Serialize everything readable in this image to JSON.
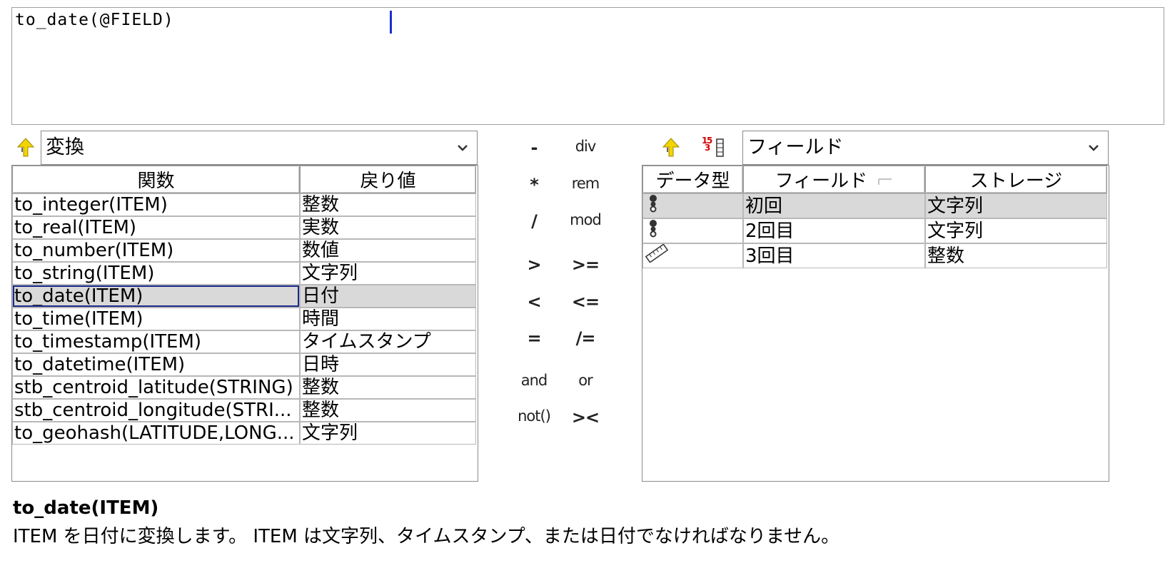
{
  "expression": {
    "text": "to_date(@FIELD)"
  },
  "functions": {
    "category": "変換",
    "columns": [
      "関数",
      "戻り値"
    ],
    "rows": [
      {
        "name": "to_integer(ITEM)",
        "ret": "整数"
      },
      {
        "name": "to_real(ITEM)",
        "ret": "実数"
      },
      {
        "name": "to_number(ITEM)",
        "ret": "数値"
      },
      {
        "name": "to_string(ITEM)",
        "ret": "文字列"
      },
      {
        "name": "to_date(ITEM)",
        "ret": "日付"
      },
      {
        "name": "to_time(ITEM)",
        "ret": "時間"
      },
      {
        "name": "to_timestamp(ITEM)",
        "ret": "タイムスタンプ"
      },
      {
        "name": "to_datetime(ITEM)",
        "ret": "日時"
      },
      {
        "name": "stb_centroid_latitude(STRING)",
        "ret": "整数"
      },
      {
        "name": "stb_centroid_longitude(STRI...",
        "ret": "整数"
      },
      {
        "name": "to_geohash(LATITUDE,LONG...",
        "ret": "文字列"
      }
    ],
    "selected_index": 4
  },
  "operators": [
    [
      "-",
      "div"
    ],
    [
      "*",
      "rem"
    ],
    [
      "/",
      "mod"
    ],
    [
      ">",
      ">="
    ],
    [
      "<",
      "<="
    ],
    [
      "=",
      "/="
    ],
    [
      "and",
      "or"
    ],
    [
      "not()",
      "><"
    ]
  ],
  "fields": {
    "category": "フィールド",
    "columns": [
      "データ型",
      "フィールド",
      "ストレージ"
    ],
    "rows": [
      {
        "type_icon": "categorical-icon",
        "field": "初回",
        "storage": "文字列"
      },
      {
        "type_icon": "categorical-icon",
        "field": "2回目",
        "storage": "文字列"
      },
      {
        "type_icon": "continuous-ruler-icon",
        "field": "3回目",
        "storage": "整数"
      }
    ],
    "selected_index": 0
  },
  "help": {
    "title": "to_date(ITEM)",
    "text": "ITEM を日付に変換します。 ITEM は文字列、タイムスタンプ、または日付でなければなりません。"
  },
  "colors": {
    "caret": "#1a2fd0",
    "selection": "#d9d9d9",
    "focus": "#1c2a8a",
    "up_arrow": "#f2d400"
  }
}
